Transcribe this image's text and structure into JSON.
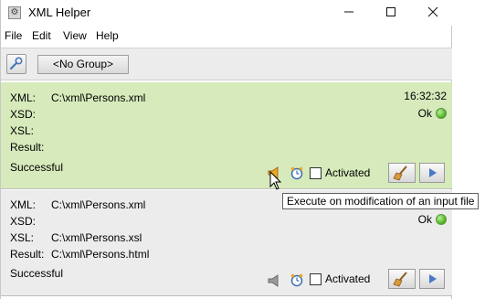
{
  "window": {
    "title": "XML Helper",
    "app_icon": "gear-icon"
  },
  "menu": {
    "items": [
      "File",
      "Edit",
      "View",
      "Help"
    ]
  },
  "toolbar": {
    "tool_icon": "wrench-icon",
    "group_label": "<No Group>"
  },
  "labels": {
    "xml": "XML:",
    "xsd": "XSD:",
    "xsl": "XSL:",
    "result": "Result:",
    "activated": "Activated"
  },
  "entries": [
    {
      "xml": "C:\\xml\\Persons.xml",
      "xsd": "",
      "xsl": "",
      "result": "",
      "status": "Successful",
      "time": "16:32:32",
      "ok": "Ok",
      "activated": false,
      "background": "#d6eabb"
    },
    {
      "xml": "C:\\xml\\Persons.xml",
      "xsd": "",
      "xsl": "C:\\xml\\Persons.xsl",
      "result": "C:\\xml\\Persons.html",
      "status": "Successful",
      "time": "",
      "ok": "Ok",
      "activated": false,
      "background": "#ececec"
    }
  ],
  "tooltip": "Execute on modification of an input file"
}
